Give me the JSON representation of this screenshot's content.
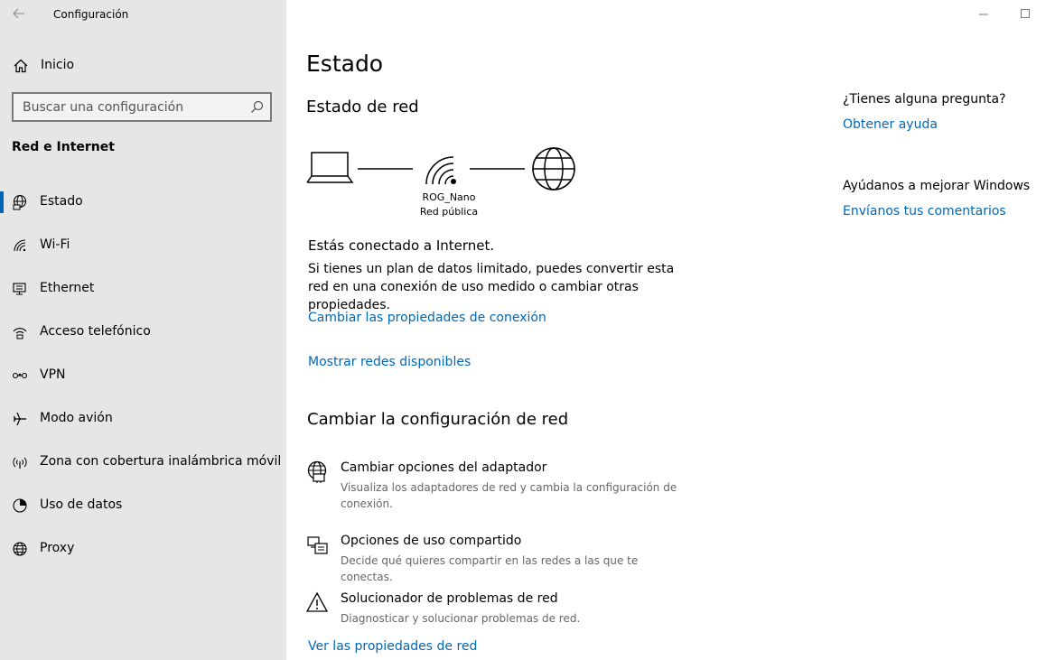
{
  "window": {
    "title": "Configuración"
  },
  "sidebar": {
    "home_label": "Inicio",
    "search_placeholder": "Buscar una configuración",
    "section_title": "Red e Internet",
    "items": [
      {
        "label": "Estado",
        "icon": "globe-status-icon",
        "active": true
      },
      {
        "label": "Wi-Fi",
        "icon": "wifi-icon",
        "active": false
      },
      {
        "label": "Ethernet",
        "icon": "ethernet-icon",
        "active": false
      },
      {
        "label": "Acceso telefónico",
        "icon": "dialup-icon",
        "active": false
      },
      {
        "label": "VPN",
        "icon": "vpn-icon",
        "active": false
      },
      {
        "label": "Modo avión",
        "icon": "airplane-icon",
        "active": false
      },
      {
        "label": "Zona con cobertura inalámbrica móvil",
        "icon": "hotspot-icon",
        "active": false
      },
      {
        "label": "Uso de datos",
        "icon": "data-usage-icon",
        "active": false
      },
      {
        "label": "Proxy",
        "icon": "proxy-globe-icon",
        "active": false
      }
    ]
  },
  "main": {
    "title": "Estado",
    "network_status": {
      "heading": "Estado de red",
      "network_name": "ROG_Nano",
      "network_type": "Red pública",
      "connected_text": "Estás conectado a Internet.",
      "description": "Si tienes un plan de datos limitado, puedes convertir esta red en una conexión de uso medido o cambiar otras propiedades.",
      "link_change_props": "Cambiar las propiedades de conexión",
      "link_show_networks": "Mostrar redes disponibles"
    },
    "change_settings": {
      "heading": "Cambiar la configuración de red",
      "options": [
        {
          "title": "Cambiar opciones del adaptador",
          "desc": "Visualiza los adaptadores de red y cambia la configuración de conexión.",
          "icon": "adapter-globe-icon"
        },
        {
          "title": "Opciones de uso compartido",
          "desc": "Decide qué quieres compartir en las redes a las que te conectas.",
          "icon": "sharing-icon"
        },
        {
          "title": "Solucionador de problemas de red",
          "desc": "Diagnosticar y solucionar problemas de red.",
          "icon": "warning-icon"
        }
      ],
      "link_view_props": "Ver las propiedades de red"
    },
    "side": {
      "question": "¿Tienes alguna pregunta?",
      "help_link": "Obtener ayuda",
      "improve": "Ayúdanos a mejorar Windows",
      "feedback_link": "Envíanos tus comentarios"
    }
  },
  "colors": {
    "accent": "#0067b8",
    "sidebar_bg": "#e6e6e6"
  }
}
